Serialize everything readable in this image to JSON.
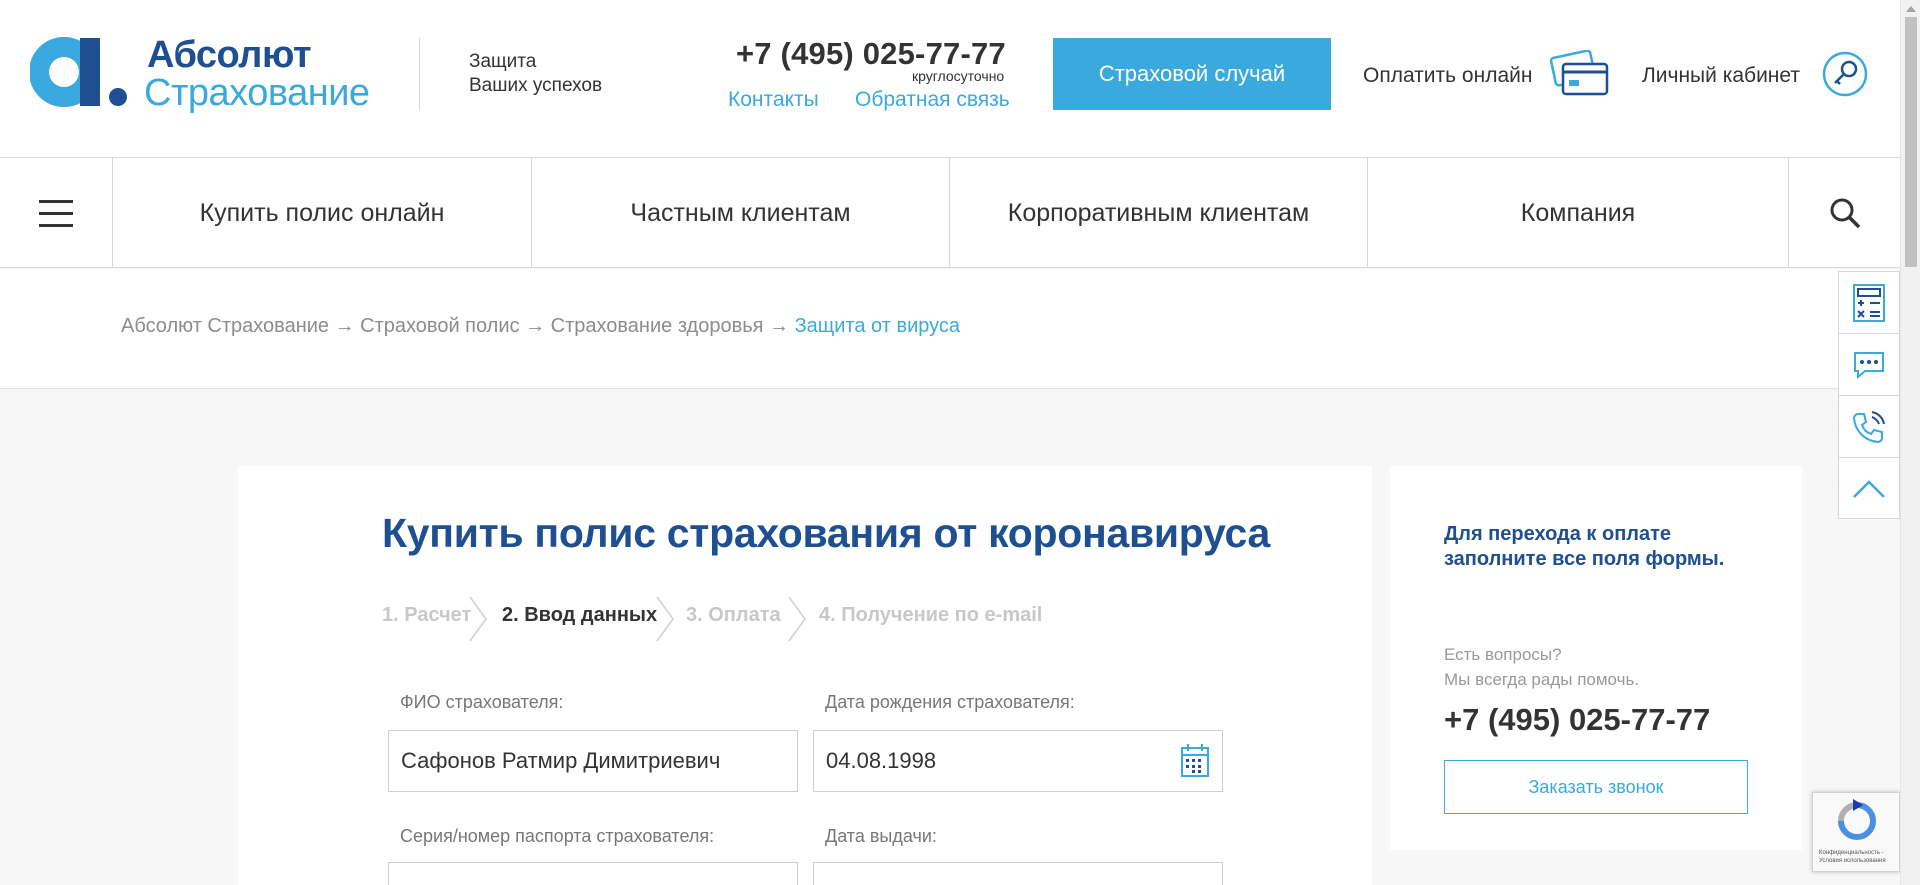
{
  "header": {
    "logo_line1": "Абсолют",
    "logo_line2": "Страхование",
    "tagline_line1": "Защита",
    "tagline_line2": "Ваших успехов",
    "phone": "+7 (495) 025-77-77",
    "phone_note": "круглосуточно",
    "contacts_link": "Контакты",
    "feedback_link": "Обратная связь",
    "insurance_case_button": "Страховой случай",
    "pay_online": "Оплатить онлайн",
    "personal_cabinet": "Личный кабинет"
  },
  "nav": {
    "items": [
      {
        "label": "Купить полис онлайн"
      },
      {
        "label": "Частным клиентам"
      },
      {
        "label": "Корпоративным клиентам"
      },
      {
        "label": "Компания"
      }
    ]
  },
  "breadcrumbs": {
    "items": [
      "Абсолют Страхование",
      "Страховой полис",
      "Страхование здоровья"
    ],
    "separator": "→",
    "current": "Защита от вируса"
  },
  "form": {
    "title": "Купить полис страхования от коронавируса",
    "steps": [
      {
        "label": "1. Расчет",
        "state": "done"
      },
      {
        "label": "2. Ввод данных",
        "state": "active"
      },
      {
        "label": "3. Оплата",
        "state": "pending"
      },
      {
        "label": "4. Получение по e-mail",
        "state": "pending"
      }
    ],
    "fio_label": "ФИО страхователя:",
    "fio_value": "Сафонов Ратмир Димитриевич",
    "birth_label": "Дата рождения страхователя:",
    "birth_value": "04.08.1998",
    "passport_label": "Серия/номер паспорта страхователя:",
    "issue_date_label": "Дата выдачи:"
  },
  "side": {
    "heading": "Для перехода к оплате заполните все поля формы.",
    "question_line1": "Есть вопросы?",
    "question_line2": "Мы всегда рады помочь.",
    "phone": "+7 (495) 025-77-77",
    "callback_button": "Заказать звонок"
  },
  "recaptcha": {
    "line1": "Конфиденциальность -",
    "line2": "Условия использования"
  },
  "colors": {
    "brand_dark": "#1d4f91",
    "brand_light": "#3aa9dd"
  }
}
